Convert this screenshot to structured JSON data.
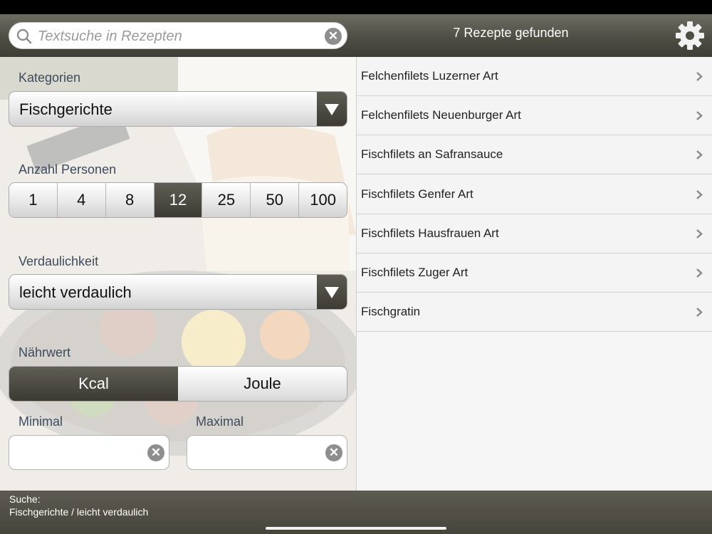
{
  "search": {
    "placeholder": "Textsuche in Rezepten",
    "clear_label": "✕"
  },
  "header": {
    "result_count": "7 Rezepte gefunden"
  },
  "filters": {
    "category_label": "Kategorien",
    "category_value": "Fischgerichte",
    "persons_label": "Anzahl Personen",
    "persons_options": [
      "1",
      "4",
      "8",
      "12",
      "25",
      "50",
      "100"
    ],
    "persons_selected": "12",
    "digestibility_label": "Verdaulichkeit",
    "digestibility_value": "leicht verdaulich",
    "nutrition_label": "Nährwert",
    "nutrition_options": [
      "Kcal",
      "Joule"
    ],
    "nutrition_selected": "Kcal",
    "min_label": "Minimal",
    "max_label": "Maximal",
    "min_value": "",
    "max_value": ""
  },
  "recipes": [
    "Felchenfilets Luzerner Art",
    "Felchenfilets Neuenburger Art",
    "Fischfilets an Safransauce",
    "Fischfilets Genfer Art",
    "Fischfilets Hausfrauen Art",
    "Fischfilets Zuger Art",
    "Fischgratin"
  ],
  "footer": {
    "line1": "Suche:",
    "line2": "Fischgerichte / leicht verdaulich"
  },
  "colors": {
    "dark_bar": "#4f4e45",
    "list_bg": "#f4f4f4",
    "label_text": "#3e4a5c"
  }
}
